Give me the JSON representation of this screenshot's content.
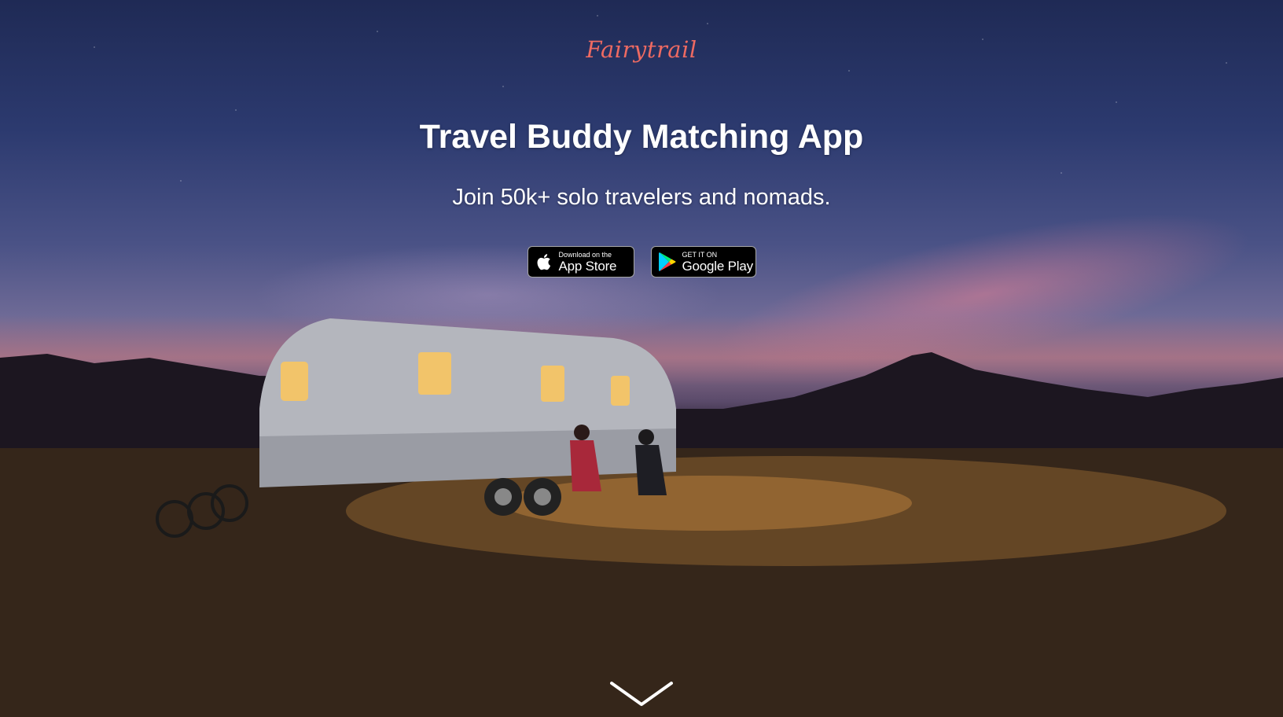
{
  "brand": {
    "logo_text": "Fairytrail"
  },
  "hero": {
    "title": "Travel Buddy Matching App",
    "subtitle": "Join 50k+ solo travelers and nomads."
  },
  "store_badges": {
    "app_store": {
      "small_text": "Download on the",
      "big_text": "App Store",
      "icon": "apple-icon"
    },
    "google_play": {
      "small_text": "GET IT ON",
      "big_text": "Google Play",
      "icon": "google-play-icon"
    }
  },
  "scroll": {
    "icon": "chevron-down-icon"
  },
  "colors": {
    "brand": "#ee6a62",
    "text": "#ffffff",
    "badge_bg": "#000000"
  }
}
